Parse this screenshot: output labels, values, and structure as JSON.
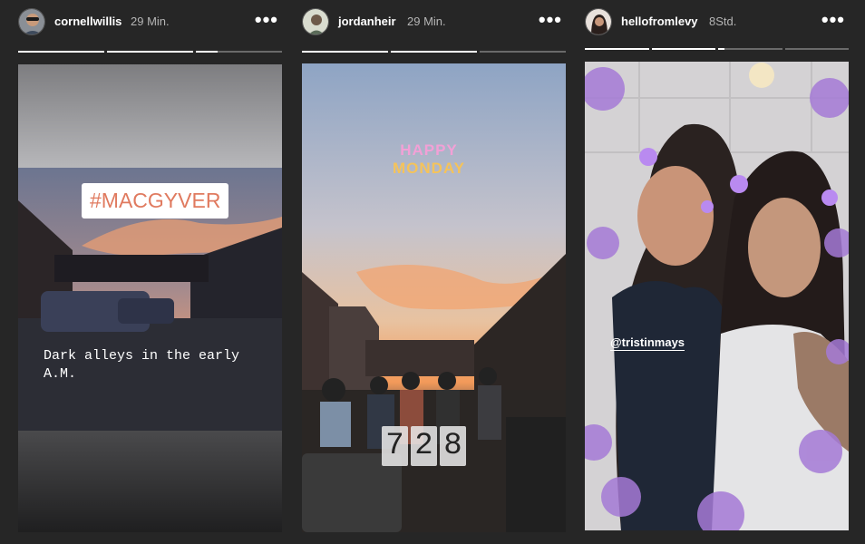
{
  "colors": {
    "background": "#262626",
    "progress_filled": "#ffffff",
    "progress_empty": "#6a6a6a"
  },
  "stories": [
    {
      "username": "cornellwillis",
      "time": "29 Min.",
      "more_label": "•••",
      "progress": [
        1,
        1,
        0.25
      ],
      "sticker": "#MACGYVER",
      "caption_line1": "Dark alleys in the early",
      "caption_line2": "A.M."
    },
    {
      "username": "jordanheir",
      "time": "29 Min.",
      "more_label": "•••",
      "progress": [
        1,
        1,
        0
      ],
      "sticker_line1": "HAPPY",
      "sticker_line2": "MONDAY",
      "clock": [
        "7",
        "2",
        "8"
      ]
    },
    {
      "username": "hellofromlevy",
      "time": "8Std.",
      "more_label": "•••",
      "progress": [
        1,
        1,
        0.1,
        0
      ],
      "mention": "@tristinmays"
    }
  ]
}
